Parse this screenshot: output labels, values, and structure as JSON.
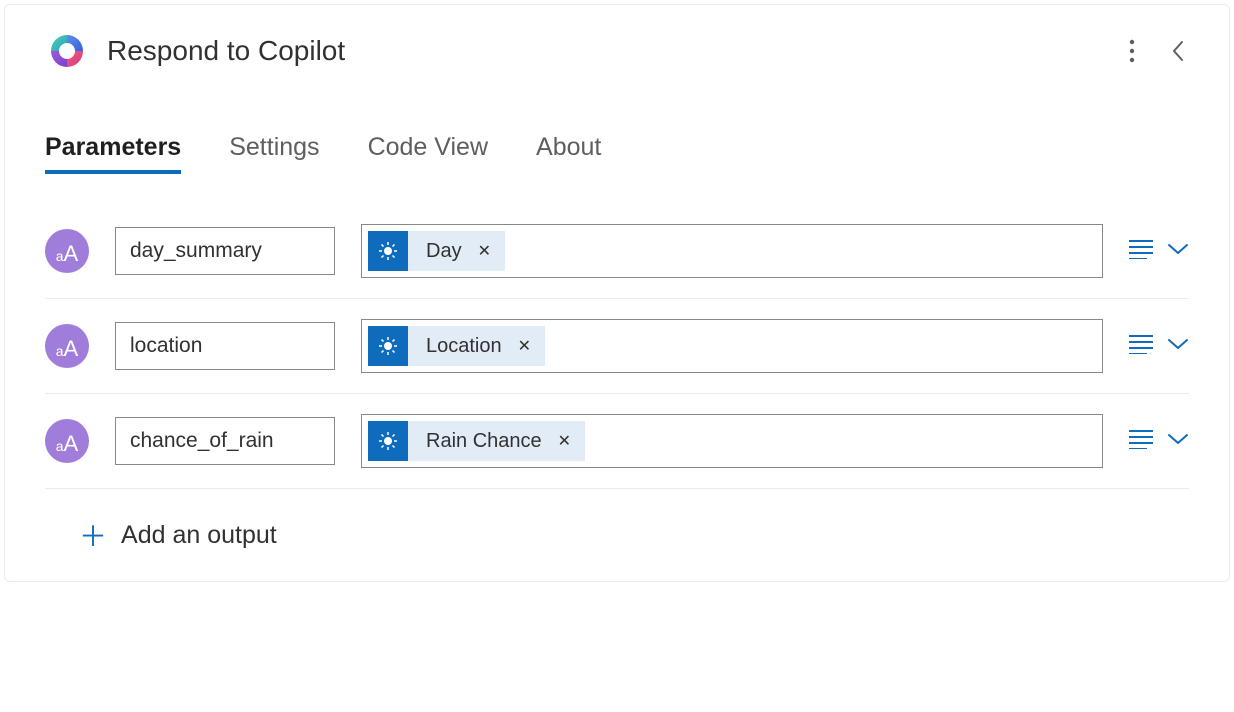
{
  "header": {
    "title": "Respond to Copilot"
  },
  "tabs": [
    {
      "label": "Parameters",
      "active": true
    },
    {
      "label": "Settings",
      "active": false
    },
    {
      "label": "Code View",
      "active": false
    },
    {
      "label": "About",
      "active": false
    }
  ],
  "parameters": [
    {
      "name": "day_summary",
      "token_label": "Day",
      "token_source": "weather"
    },
    {
      "name": "location",
      "token_label": "Location",
      "token_source": "weather"
    },
    {
      "name": "chance_of_rain",
      "token_label": "Rain Chance",
      "token_source": "weather"
    }
  ],
  "add_output_label": "Add an output",
  "icons": {
    "type_badge": "aA",
    "token_source": "sun-icon"
  },
  "colors": {
    "accent": "#0f6cbd",
    "badge": "#a17ddb",
    "token_bg": "#e1ecf7"
  }
}
